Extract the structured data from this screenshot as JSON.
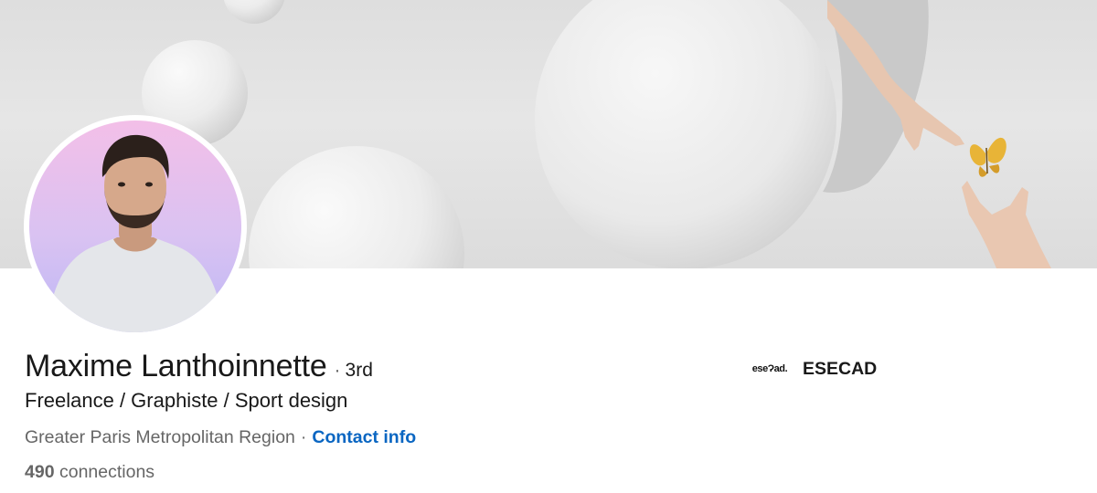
{
  "profile": {
    "name": "Maxime Lanthoinnette",
    "degree_separator": "·",
    "degree": "3rd",
    "headline": "Freelance / Graphiste / Sport design",
    "location": "Greater Paris Metropolitan Region",
    "location_separator": "·",
    "contact_link": "Contact info",
    "connections_count": "490",
    "connections_label": "connections"
  },
  "school": {
    "logo_text": "eseɁad.",
    "name": "ESECAD"
  },
  "colors": {
    "link": "#0a66c2",
    "text_primary": "#191919",
    "text_secondary": "#666666",
    "avatar_gradient_top": "#f3bfe8",
    "avatar_gradient_bottom": "#bdb7f5",
    "butterfly": "#e8b437"
  },
  "icons": {
    "banner": "banner-image-spheres-hands-butterfly",
    "avatar": "profile-photo"
  }
}
